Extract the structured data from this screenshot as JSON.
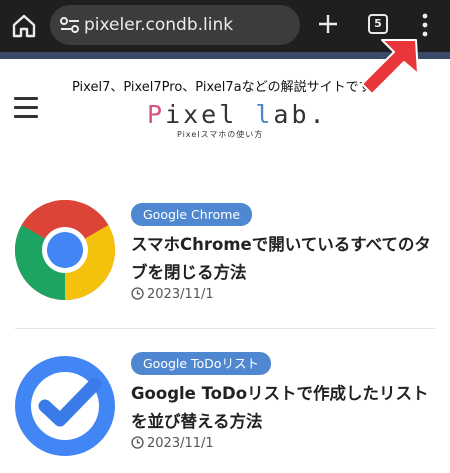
{
  "browser": {
    "url": "pixeler.condb.link",
    "tab_count": "5"
  },
  "site": {
    "tagline": "Pixel7、Pixel7Pro、Pixel7aなどの解説サイトです",
    "logo_p": "P",
    "logo_rest": "ixel ",
    "logo_l": "l",
    "logo_end": "ab.",
    "logo_sub": "Pixelスマホの使い方"
  },
  "articles": [
    {
      "category": "Google Chrome",
      "title": "スマホChromeで開いているすべてのタブを閉じる方法",
      "date": "2023/11/1",
      "thumb_icon": "chrome-logo-icon"
    },
    {
      "category": "Google ToDoリスト",
      "title": "Google ToDoリストで作成したリストを並び替える方法",
      "date": "2023/11/1",
      "thumb_icon": "google-tasks-logo-icon"
    }
  ],
  "colors": {
    "toolbar": "#1f1f1f",
    "badge": "#4f88d0",
    "arrow": "#e8363a"
  }
}
